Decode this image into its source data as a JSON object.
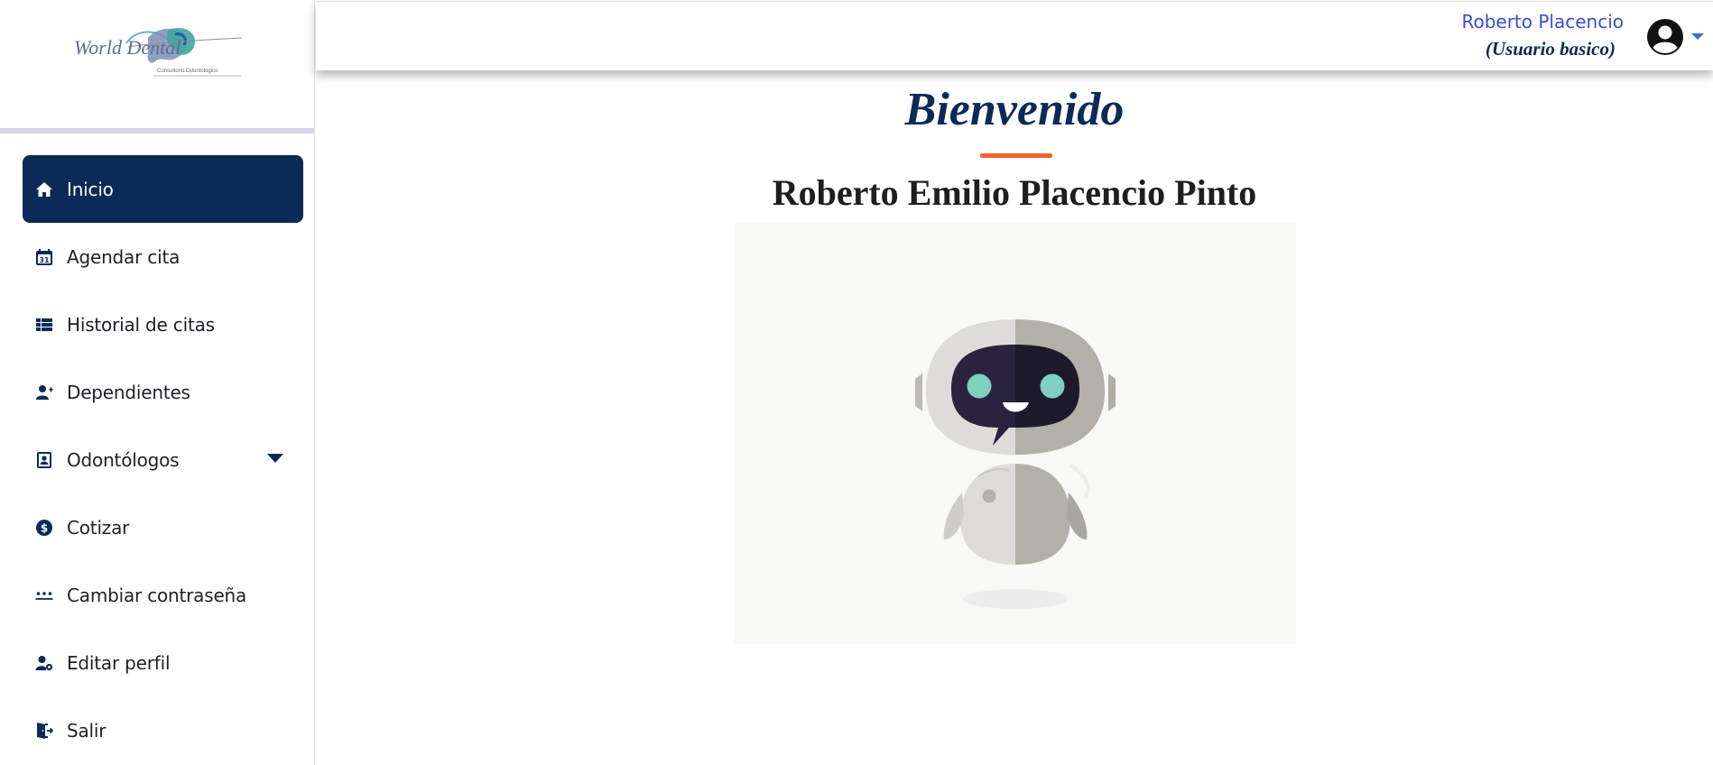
{
  "sidebar": {
    "logo_text": "World Dental",
    "logo_subtitle": "Consultorio Odontologico",
    "items": [
      {
        "label": "Inicio",
        "icon": "home-icon",
        "active": true
      },
      {
        "label": "Agendar cita",
        "icon": "calendar-icon",
        "calendar_day": "31"
      },
      {
        "label": "Historial de citas",
        "icon": "list-icon"
      },
      {
        "label": "Dependientes",
        "icon": "user-plus-icon"
      },
      {
        "label": "Odontólogos",
        "icon": "contact-book-icon",
        "has_dropdown": true
      },
      {
        "label": "Cotizar",
        "icon": "dollar-icon"
      },
      {
        "label": "Cambiar contraseña",
        "icon": "password-dots-icon"
      },
      {
        "label": "Editar perfil",
        "icon": "user-gear-icon"
      },
      {
        "label": "Salir",
        "icon": "door-exit-icon"
      }
    ]
  },
  "header": {
    "user_name": "Roberto Placencio",
    "user_role": "(Usuario basico)",
    "avatar_icon": "user-circle-icon"
  },
  "main": {
    "welcome": "Bienvenido",
    "full_name": "Roberto Emilio Placencio Pinto",
    "image": "robot-chatbot-illustration"
  },
  "colors": {
    "primary": "#0b2a57",
    "accent": "#f0652a",
    "link": "#3b4fc8"
  }
}
